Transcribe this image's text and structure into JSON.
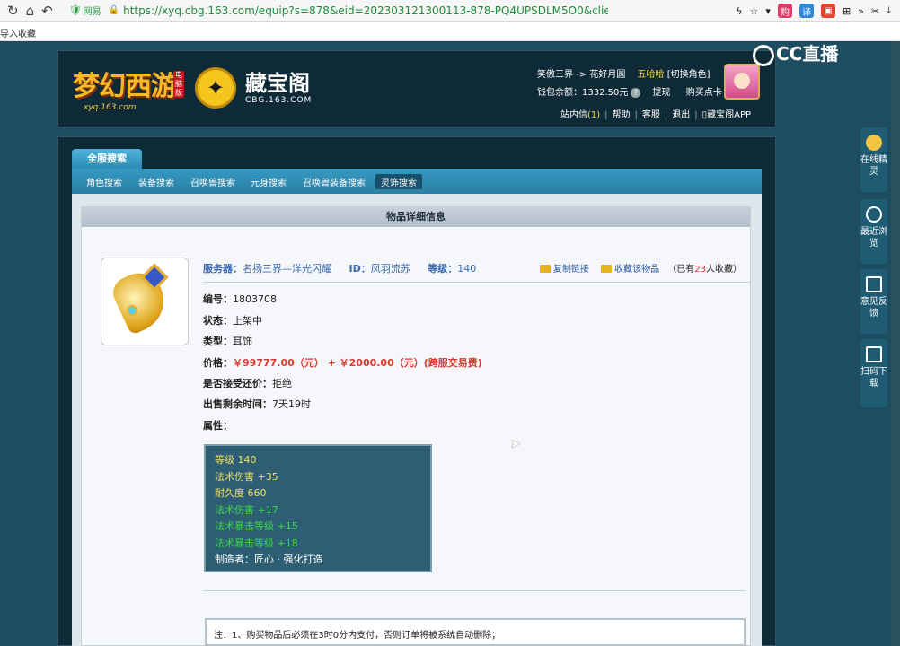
{
  "browser": {
    "secure_label": "网易",
    "url_prefix": "https://",
    "url_host": "xyq.cbg.163.com",
    "url_path": "/equip?s=878&eid=202303121300113-878-PQ4UPSDLM5O0&client_ty",
    "bookmark_bar": "导入收藏"
  },
  "header": {
    "game_logo_text": "梦幻西游",
    "game_logo_sub": "xyq.163.com",
    "game_logo_badge": "电脑版",
    "cbg_title": "藏宝阁",
    "cbg_sub": "CBG.163.COM",
    "server_path": "笑傲三界 -> 花好月圆",
    "user_name": "五哈哈",
    "switch_role": "[切换角色]",
    "wallet_label": "钱包余额：",
    "wallet_value": "1332.50元",
    "withdraw": "提现",
    "buy_card": "购买点卡",
    "links": [
      "站内信",
      "帮助",
      "客服",
      "退出",
      "藏宝阁APP"
    ],
    "message_count": "(1)"
  },
  "watermark": {
    "text": "CC直播"
  },
  "nav": {
    "all_server_tab": "全服搜索",
    "sub_items": [
      "角色搜索",
      "装备搜索",
      "召唤兽搜索",
      "元身搜索",
      "召唤兽装备搜索",
      "灵饰搜索"
    ],
    "active_index": 5
  },
  "detail": {
    "title": "物品详细信息",
    "server_label": "服务器：",
    "server_value": "名扬三界—洋光闪耀",
    "id_label": "ID：",
    "id_value": "凤羽流苏",
    "level_label": "等级：",
    "level_value": "140",
    "copy_link": "复制链接",
    "favorite": "收藏该物品",
    "fav_prefix": "（已有",
    "fav_count": "23",
    "fav_suffix": "人收藏）",
    "rows": [
      {
        "label": "编号：",
        "value": "1803708"
      },
      {
        "label": "状态：",
        "value": "上架中"
      },
      {
        "label": "类型：",
        "value": "耳饰"
      },
      {
        "label": "价格：",
        "value": "￥99777.00（元） + ￥2000.00（元）(跨服交易费)"
      },
      {
        "label": "是否接受还价：",
        "value": "拒绝"
      },
      {
        "label": "出售剩余时间：",
        "value": "7天19时"
      },
      {
        "label": "属性：",
        "value": ""
      }
    ],
    "attributes": [
      {
        "text": "等级 140",
        "color": "yellow"
      },
      {
        "text": "法术伤害 +35",
        "color": "yellow"
      },
      {
        "text": "耐久度 660",
        "color": "yellow"
      },
      {
        "text": "法术伤害 +17",
        "color": "green"
      },
      {
        "text": "法术暴击等级 +15",
        "color": "green"
      },
      {
        "text": "法术暴击等级 +18",
        "color": "green"
      },
      {
        "text": "制造者：匠心 · 强化打造",
        "color": "white"
      }
    ],
    "note": "注：1、购买物品后必须在3时0分内支付，否则订单将被系统自动删除；"
  },
  "rail": [
    {
      "label": "在线精灵"
    },
    {
      "label": "最近浏览"
    },
    {
      "label": "意见反馈"
    },
    {
      "label": "扫码下载"
    }
  ],
  "colors": {
    "page_bg": "#1c4d60",
    "nav_blue": "#3499c2",
    "price_red": "#d8392b",
    "attr_yellow": "#f2e066",
    "attr_green": "#39d84a"
  }
}
